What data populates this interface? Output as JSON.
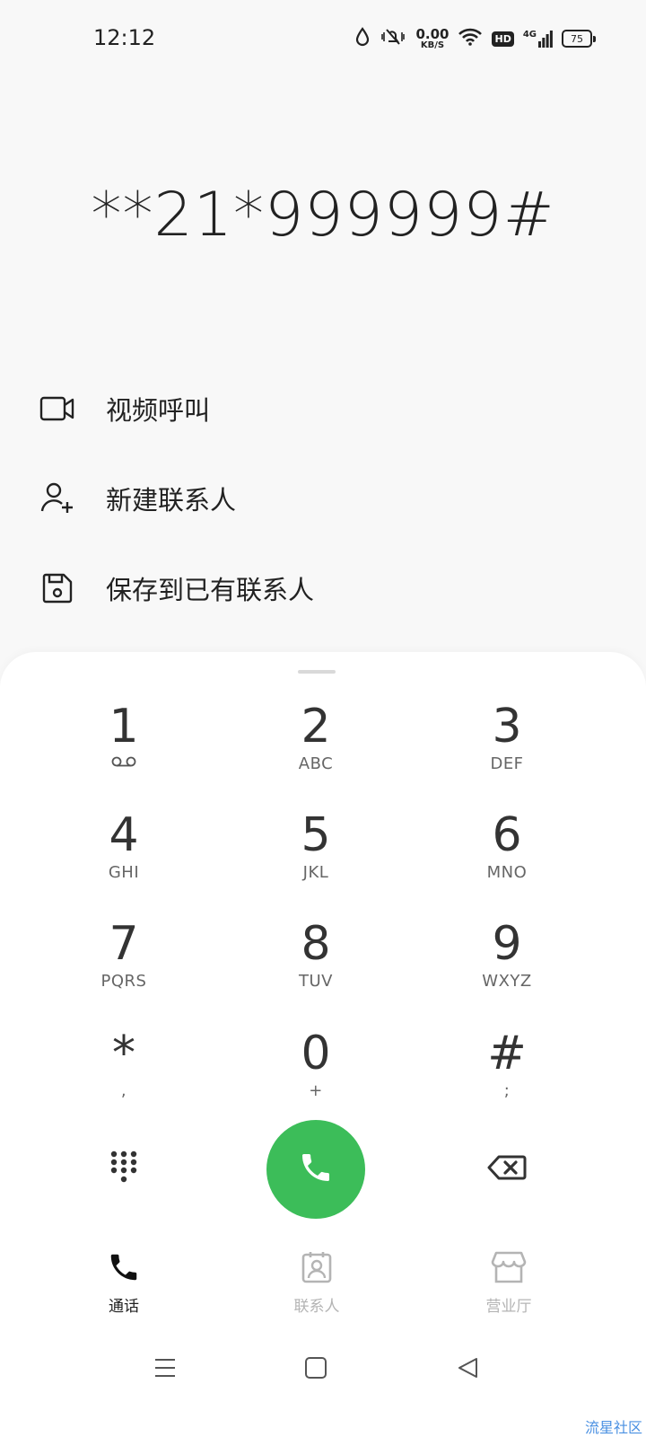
{
  "status_bar": {
    "time": "12:12",
    "net_speed": "0.00",
    "net_unit": "KB/S",
    "hd": "HD",
    "network": "4G",
    "battery": "75"
  },
  "dialed_number": "**21*999999#",
  "actions": [
    {
      "label": "视频呼叫",
      "icon": "video-camera-icon"
    },
    {
      "label": "新建联系人",
      "icon": "add-person-icon"
    },
    {
      "label": "保存到已有联系人",
      "icon": "save-floppy-icon"
    }
  ],
  "keypad": [
    {
      "num": "1",
      "letters": ""
    },
    {
      "num": "2",
      "letters": "ABC"
    },
    {
      "num": "3",
      "letters": "DEF"
    },
    {
      "num": "4",
      "letters": "GHI"
    },
    {
      "num": "5",
      "letters": "JKL"
    },
    {
      "num": "6",
      "letters": "MNO"
    },
    {
      "num": "7",
      "letters": "PQRS"
    },
    {
      "num": "8",
      "letters": "TUV"
    },
    {
      "num": "9",
      "letters": "WXYZ"
    },
    {
      "num": "*",
      "letters": ","
    },
    {
      "num": "0",
      "letters": "+"
    },
    {
      "num": "#",
      "letters": ";"
    }
  ],
  "tabs": [
    {
      "label": "通话",
      "icon": "phone-icon",
      "active": true
    },
    {
      "label": "联系人",
      "icon": "contact-card-icon",
      "active": false
    },
    {
      "label": "营业厅",
      "icon": "store-icon",
      "active": false
    }
  ],
  "colors": {
    "call_green": "#3cbd59",
    "inactive_tab": "#b4b4b4",
    "watermark": "#4a90e2"
  },
  "watermark": "流星社区"
}
